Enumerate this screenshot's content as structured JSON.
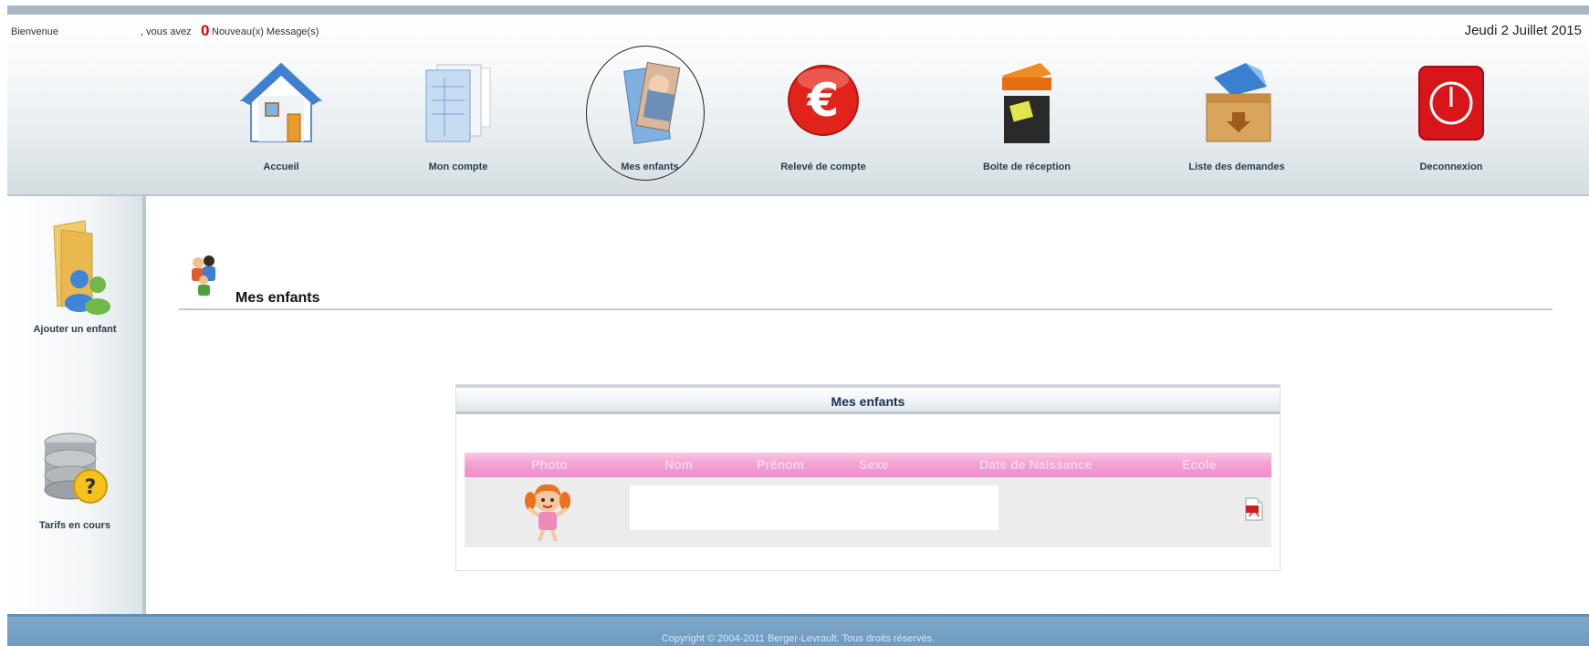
{
  "header": {
    "welcome": "Bienvenue",
    "you_have": ", vous avez",
    "message_count": "0",
    "messages_label": "Nouveau(x) Message(s)",
    "date": "Jeudi 2 Juillet 2015"
  },
  "nav": [
    {
      "label": "Accueil",
      "icon": "house-icon"
    },
    {
      "label": "Mon compte",
      "icon": "documents-icon"
    },
    {
      "label": "Mes enfants",
      "icon": "child-photo-icon"
    },
    {
      "label": "Relevé de compte",
      "icon": "euro-icon"
    },
    {
      "label": "Boite de réception",
      "icon": "inbox-icon"
    },
    {
      "label": "Liste des demandes",
      "icon": "request-box-icon"
    },
    {
      "label": "Deconnexion",
      "icon": "power-icon"
    }
  ],
  "sidebar": {
    "items": [
      {
        "label": "Ajouter un enfant",
        "icon": "folder-users-icon"
      },
      {
        "label": "Tarifs en cours",
        "icon": "database-question-icon"
      }
    ]
  },
  "page": {
    "title": "Mes enfants",
    "icon": "family-icon"
  },
  "panel": {
    "title": "Mes enfants",
    "columns": [
      "Photo",
      "Nom",
      "Prénom",
      "Sexe",
      "Date de Naissance",
      "Ecole"
    ],
    "rows": [
      {
        "photo_icon": "girl-avatar-icon",
        "nom": "",
        "prenom": "",
        "sexe": "",
        "date_naissance": "",
        "ecole": "",
        "action_icon": "pdf-icon"
      }
    ]
  },
  "footer": {
    "copyright": "Copyright © 2004-2011 Berger-Levrault. Tous droits réservés."
  }
}
